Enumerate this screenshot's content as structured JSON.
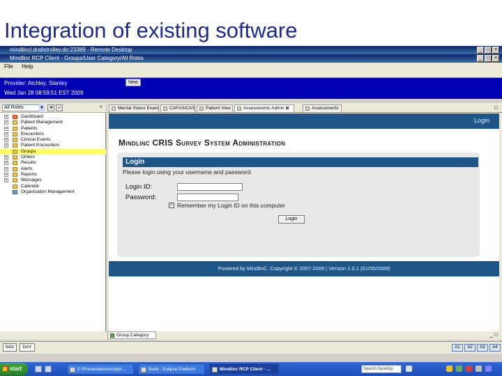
{
  "slide": {
    "title": "Integration of existing software"
  },
  "remote": {
    "title": "mindlincl.drallstrolley.do:23389 - Remote Desktop",
    "app_title": "Mindlinc RCP Client - Groups/User Category/All Roles",
    "menu": [
      "File",
      "Help"
    ]
  },
  "provider": {
    "name_line": "Provider: Atchley, Stanley",
    "date_line": "Wed Jan 28 08:59:51 EST 2009",
    "new_label": "New"
  },
  "left": {
    "combo_value": "All Roles",
    "tree": [
      {
        "label": "Dashboard",
        "icon": "dashboard-icon",
        "expand": "+",
        "selected": false
      },
      {
        "label": "Patient Management",
        "icon": "folder-icon",
        "expand": "+",
        "selected": false
      },
      {
        "label": "Patients",
        "icon": "folder-icon",
        "expand": "+",
        "selected": false
      },
      {
        "label": "Encounters",
        "icon": "folder-icon",
        "expand": "+",
        "selected": false
      },
      {
        "label": "Clinical Events",
        "icon": "folder-icon",
        "expand": "+",
        "selected": false
      },
      {
        "label": "Patient Encounters",
        "icon": "folder-icon",
        "expand": "+",
        "selected": false
      },
      {
        "label": "Groups",
        "icon": "folder-icon",
        "expand": "",
        "selected": true
      },
      {
        "label": "Orders",
        "icon": "folder-icon",
        "expand": "+",
        "selected": false
      },
      {
        "label": "Results",
        "icon": "folder-icon",
        "expand": "+",
        "selected": false
      },
      {
        "label": "Alerts",
        "icon": "folder-icon",
        "expand": "+",
        "selected": false
      },
      {
        "label": "Reports",
        "icon": "folder-icon",
        "expand": "+",
        "selected": false
      },
      {
        "label": "Messages",
        "icon": "folder-icon",
        "expand": "+",
        "selected": false
      },
      {
        "label": "Calendar",
        "icon": "folder-icon",
        "expand": "",
        "selected": false
      },
      {
        "label": "Organization Management",
        "icon": "gear-icon",
        "expand": "",
        "selected": false
      }
    ]
  },
  "tabs": [
    {
      "label": "Mental Status Exam"
    },
    {
      "label": "CAFAS/CAS"
    },
    {
      "label": "Patient View"
    },
    {
      "label": "Assessments Admin"
    },
    {
      "label": "Assessments"
    }
  ],
  "web": {
    "login_link": "Login",
    "heading": "Mindlinc CRIS Survey System Administration",
    "login_header": "Login",
    "instructions": "Please login using your username and password.",
    "login_id_label": "Login ID:",
    "password_label": "Password:",
    "remember_label": "Remember my Login ID on this computer",
    "login_button": "Login",
    "footer": "Powered by MindlinC. Copyright © 2007-2009 | Version 1.0.1 (01/05/2009)"
  },
  "bottom_tab": {
    "label": "Group Category"
  },
  "status": {
    "left_buttons": [
      "NAV",
      "DAY"
    ],
    "right_buttons": [
      "A1",
      "A2",
      "A3",
      "A4"
    ]
  },
  "taskbar": {
    "start_label": "start",
    "items": [
      {
        "label": "E:\\Presentations\\cdph...",
        "active": false
      },
      {
        "label": "Build - Eclipse Platform",
        "active": false
      },
      {
        "label": "Mindlinc RCP Client - ...",
        "active": true
      }
    ],
    "search_placeholder": "Search Desktop",
    "colors": {
      "taskbar": "#1e4eb8",
      "start": "#3ea53a",
      "band": "#0000b4",
      "header": "#1e5787"
    }
  }
}
